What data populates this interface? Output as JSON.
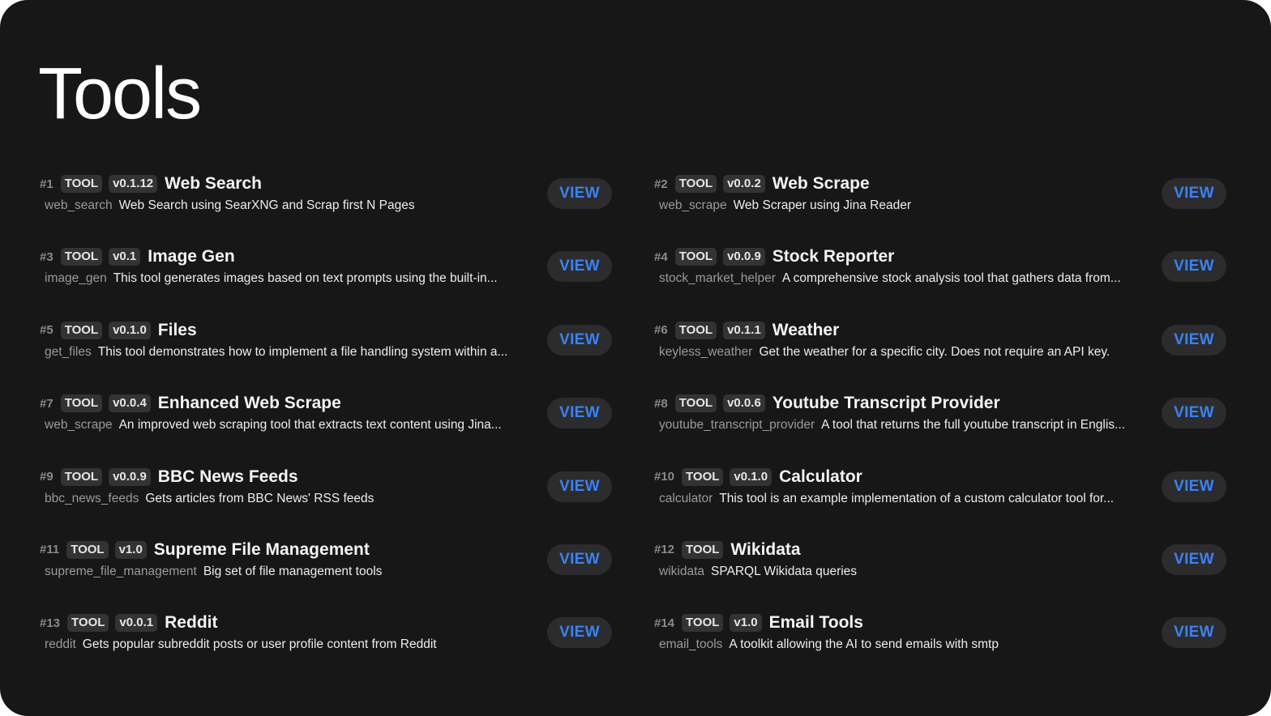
{
  "page": {
    "title": "Tools"
  },
  "badge_label": "TOOL",
  "view_label": "VIEW",
  "colors": {
    "background": "#171717",
    "view_text": "#3a82f6",
    "badge_bg": "#333333"
  },
  "tools": [
    {
      "num": "#1",
      "type": "TOOL",
      "version": "v0.1.12",
      "title": "Web Search",
      "id": "web_search",
      "desc": "Web Search using SearXNG and Scrap first N Pages"
    },
    {
      "num": "#2",
      "type": "TOOL",
      "version": "v0.0.2",
      "title": "Web Scrape",
      "id": "web_scrape",
      "desc": "Web Scraper using Jina Reader"
    },
    {
      "num": "#3",
      "type": "TOOL",
      "version": "v0.1",
      "title": "Image Gen",
      "id": "image_gen",
      "desc": "This tool generates images based on text prompts using the built-in..."
    },
    {
      "num": "#4",
      "type": "TOOL",
      "version": "v0.0.9",
      "title": "Stock Reporter",
      "id": "stock_market_helper",
      "desc": "A comprehensive stock analysis tool that gathers data from..."
    },
    {
      "num": "#5",
      "type": "TOOL",
      "version": "v0.1.0",
      "title": "Files",
      "id": "get_files",
      "desc": "This tool demonstrates how to implement a file handling system within a..."
    },
    {
      "num": "#6",
      "type": "TOOL",
      "version": "v0.1.1",
      "title": "Weather",
      "id": "keyless_weather",
      "desc": "Get the weather for a specific city. Does not require an API key."
    },
    {
      "num": "#7",
      "type": "TOOL",
      "version": "v0.0.4",
      "title": "Enhanced Web Scrape",
      "id": "web_scrape",
      "desc": "An improved web scraping tool that extracts text content using Jina..."
    },
    {
      "num": "#8",
      "type": "TOOL",
      "version": "v0.0.6",
      "title": "Youtube Transcript Provider",
      "id": "youtube_transcript_provider",
      "desc": "A tool that returns the full youtube transcript in Englis..."
    },
    {
      "num": "#9",
      "type": "TOOL",
      "version": "v0.0.9",
      "title": "BBC News Feeds",
      "id": "bbc_news_feeds",
      "desc": "Gets articles from BBC News' RSS feeds"
    },
    {
      "num": "#10",
      "type": "TOOL",
      "version": "v0.1.0",
      "title": "Calculator",
      "id": "calculator",
      "desc": "This tool is an example implementation of a custom calculator tool for..."
    },
    {
      "num": "#11",
      "type": "TOOL",
      "version": "v1.0",
      "title": "Supreme File Management",
      "id": "supreme_file_management",
      "desc": "Big set of file management tools"
    },
    {
      "num": "#12",
      "type": "TOOL",
      "version": "",
      "title": "Wikidata",
      "id": "wikidata",
      "desc": "SPARQL Wikidata queries"
    },
    {
      "num": "#13",
      "type": "TOOL",
      "version": "v0.0.1",
      "title": "Reddit",
      "id": "reddit",
      "desc": "Gets popular subreddit posts or user profile content from Reddit"
    },
    {
      "num": "#14",
      "type": "TOOL",
      "version": "v1.0",
      "title": "Email Tools",
      "id": "email_tools",
      "desc": "A toolkit allowing the AI to send emails with smtp"
    }
  ]
}
